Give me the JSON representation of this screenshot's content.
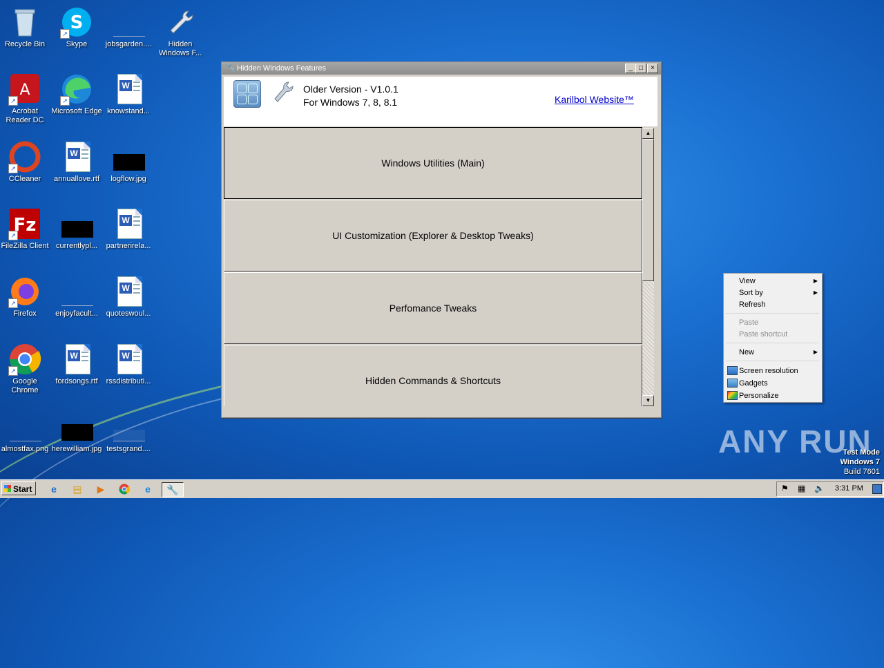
{
  "desktop": {
    "icons": [
      {
        "label": "Recycle Bin"
      },
      {
        "label": "Skype"
      },
      {
        "label": "jobsgarden...."
      },
      {
        "label": "Hidden Windows F..."
      },
      {
        "label": "Acrobat Reader DC"
      },
      {
        "label": "Microsoft Edge"
      },
      {
        "label": "knowstand..."
      },
      {
        "label": "CCleaner"
      },
      {
        "label": "annuallove.rtf"
      },
      {
        "label": "logflow.jpg"
      },
      {
        "label": "FileZilla Client"
      },
      {
        "label": "currentlypl..."
      },
      {
        "label": "partnerirela..."
      },
      {
        "label": "Firefox"
      },
      {
        "label": "enjoyfacult..."
      },
      {
        "label": "quoteswoul..."
      },
      {
        "label": "Google Chrome"
      },
      {
        "label": "fordsongs.rtf"
      },
      {
        "label": "rssdistributi..."
      },
      {
        "label": "almostfax.png"
      },
      {
        "label": "herewilliam.jpg"
      },
      {
        "label": "testsgrand...."
      }
    ]
  },
  "window": {
    "title": "Hidden Windows Features",
    "version_line1": "Older Version - V1.0.1",
    "version_line2": "For Windows 7, 8, 8.1",
    "website_link": "Karilbol Website™",
    "buttons": [
      {
        "label": "Windows Utilities (Main)"
      },
      {
        "label": "UI Customization (Explorer & Desktop Tweaks)"
      },
      {
        "label": "Perfomance Tweaks"
      },
      {
        "label": "Hidden Commands & Shortcuts"
      }
    ]
  },
  "context_menu": {
    "view": "View",
    "sort_by": "Sort by",
    "refresh": "Refresh",
    "paste": "Paste",
    "paste_shortcut": "Paste shortcut",
    "new": "New",
    "screen_resolution": "Screen resolution",
    "gadgets": "Gadgets",
    "personalize": "Personalize"
  },
  "taskbar": {
    "start_label": "Start",
    "clock": "3:31 PM"
  },
  "watermark": {
    "brand": "ANY RUN",
    "test_mode": "Test Mode",
    "os": "Windows 7",
    "build": "Build 7601"
  },
  "colors": {
    "link": "#0000cc",
    "desktop_bg": "#1a6fd0"
  }
}
